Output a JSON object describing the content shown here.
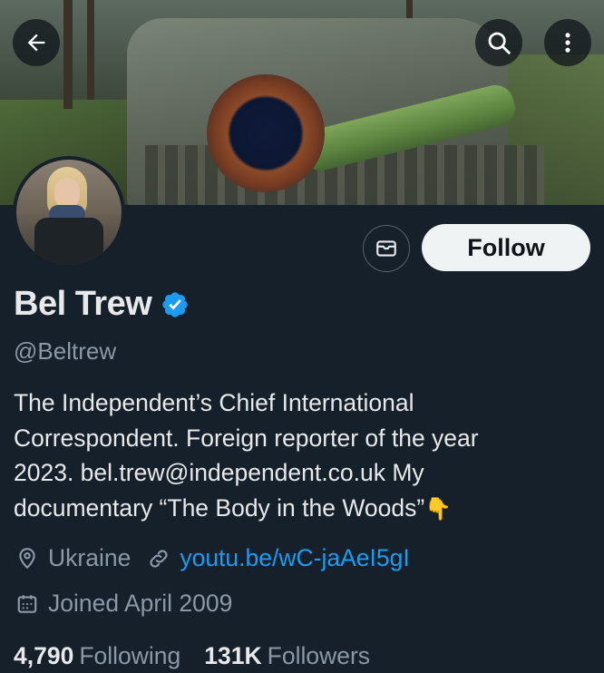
{
  "header": {
    "back_icon": "arrow-left-icon",
    "search_icon": "search-icon",
    "more_icon": "more-vertical-icon"
  },
  "profile": {
    "name": "Bel Trew",
    "verified": true,
    "handle": "@Beltrew",
    "bio_lines": [
      "The Independent’s Chief International",
      "Correspondent. Foreign reporter of the year",
      "2023. bel.trew@independent.co.uk My",
      "documentary “The Body in the Woods”"
    ],
    "bio_emoji": "👇",
    "location": "Ukraine",
    "link": "youtu.be/wC-jaAeI5gI",
    "joined": "Joined April 2009",
    "following_count": "4,790",
    "following_label": "Following",
    "followers_count": "131K",
    "followers_label": "Followers"
  },
  "actions": {
    "message_icon": "envelope-icon",
    "follow_label": "Follow"
  },
  "colors": {
    "background": "#15202b",
    "accent": "#1d9bf0",
    "secondary_text": "#8b98a5"
  }
}
